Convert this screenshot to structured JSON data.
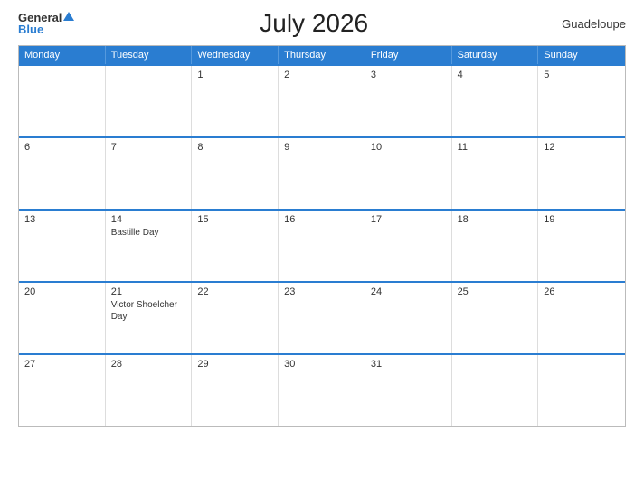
{
  "header": {
    "logo_general": "General",
    "logo_blue": "Blue",
    "title": "July 2026",
    "region": "Guadeloupe"
  },
  "days_of_week": [
    "Monday",
    "Tuesday",
    "Wednesday",
    "Thursday",
    "Friday",
    "Saturday",
    "Sunday"
  ],
  "weeks": [
    [
      {
        "day": "",
        "events": []
      },
      {
        "day": "",
        "events": []
      },
      {
        "day": "1",
        "events": []
      },
      {
        "day": "2",
        "events": []
      },
      {
        "day": "3",
        "events": []
      },
      {
        "day": "4",
        "events": []
      },
      {
        "day": "5",
        "events": []
      }
    ],
    [
      {
        "day": "6",
        "events": []
      },
      {
        "day": "7",
        "events": []
      },
      {
        "day": "8",
        "events": []
      },
      {
        "day": "9",
        "events": []
      },
      {
        "day": "10",
        "events": []
      },
      {
        "day": "11",
        "events": []
      },
      {
        "day": "12",
        "events": []
      }
    ],
    [
      {
        "day": "13",
        "events": []
      },
      {
        "day": "14",
        "events": [
          "Bastille Day"
        ]
      },
      {
        "day": "15",
        "events": []
      },
      {
        "day": "16",
        "events": []
      },
      {
        "day": "17",
        "events": []
      },
      {
        "day": "18",
        "events": []
      },
      {
        "day": "19",
        "events": []
      }
    ],
    [
      {
        "day": "20",
        "events": []
      },
      {
        "day": "21",
        "events": [
          "Victor Shoelcher Day"
        ]
      },
      {
        "day": "22",
        "events": []
      },
      {
        "day": "23",
        "events": []
      },
      {
        "day": "24",
        "events": []
      },
      {
        "day": "25",
        "events": []
      },
      {
        "day": "26",
        "events": []
      }
    ],
    [
      {
        "day": "27",
        "events": []
      },
      {
        "day": "28",
        "events": []
      },
      {
        "day": "29",
        "events": []
      },
      {
        "day": "30",
        "events": []
      },
      {
        "day": "31",
        "events": []
      },
      {
        "day": "",
        "events": []
      },
      {
        "day": "",
        "events": []
      }
    ]
  ]
}
